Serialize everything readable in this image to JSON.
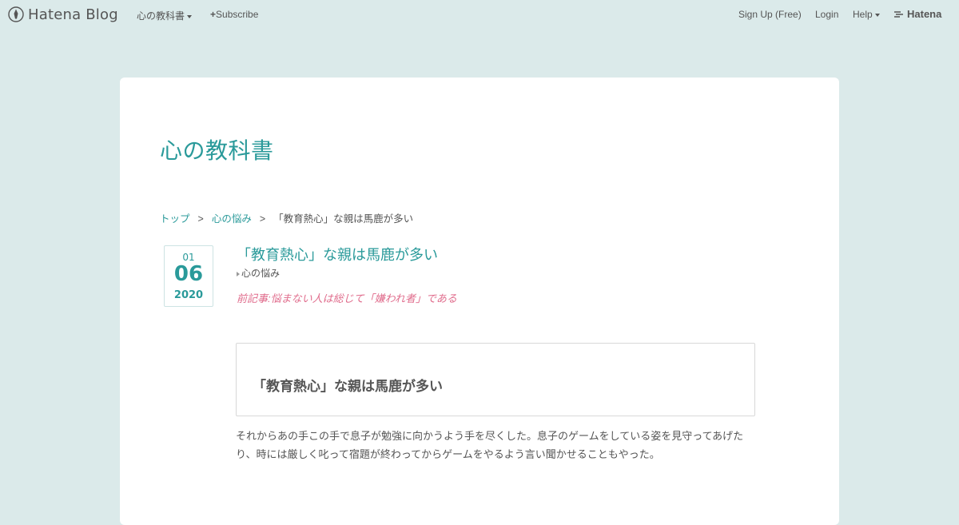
{
  "globalheader": {
    "brand": "Hatena Blog",
    "blog_menu_label": "心の教科書",
    "subscribe_label": "Subscribe",
    "signup_label": "Sign Up (Free)",
    "login_label": "Login",
    "help_label": "Help",
    "hatena_label": "Hatena"
  },
  "blog": {
    "title": "心の教科書"
  },
  "breadcrumb": {
    "items": [
      "トップ",
      "心の悩み"
    ],
    "separator": ">",
    "current": "「教育熱心」な親は馬鹿が多い"
  },
  "entry": {
    "date": {
      "month": "01",
      "day": "06",
      "year": "2020"
    },
    "title": "「教育熱心」な親は馬鹿が多い",
    "category": "心の悩み",
    "prev_link": "前記事:悩まない人は総じて「嫌われ者」である",
    "heading": "「教育熱心」な親は馬鹿が多い",
    "paragraph": "それからあの手この手で息子が勉強に向かうよう手を尽くした。息子のゲームをしている姿を見守ってあげたり、時には厳しく叱って宿題が終わってからゲームをやるよう言い聞かせることもやった。"
  },
  "colors": {
    "background": "#dbeaea",
    "accent": "#2a9a9a",
    "prev_link": "#e06c8c"
  }
}
